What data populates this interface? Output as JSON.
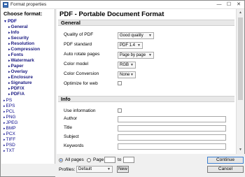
{
  "window": {
    "title": "Format properties",
    "min": "—",
    "max": "☐",
    "close": "✕"
  },
  "left": {
    "heading": "Choose format:",
    "formats": [
      {
        "label": "PDF",
        "children": [
          "General",
          "Info",
          "Security",
          "Resolution",
          "Compression",
          "Fonts",
          "Watermark",
          "Paper",
          "Overlay",
          "Enclosure",
          "Signature",
          "PDF/X",
          "PDF/A"
        ]
      },
      {
        "label": "PS"
      },
      {
        "label": "EPS"
      },
      {
        "label": "PCL"
      },
      {
        "label": "PNG"
      },
      {
        "label": "JPEG"
      },
      {
        "label": "BMP"
      },
      {
        "label": "PCX"
      },
      {
        "label": "TIFF"
      },
      {
        "label": "PSD"
      },
      {
        "label": "TXT"
      }
    ]
  },
  "main": {
    "title": "PDF - Portable Document Format",
    "general": {
      "heading": "General",
      "quality_label": "Quality of PDF",
      "quality_value": "Good quality",
      "standard_label": "PDF standard",
      "standard_value": "PDF 1.4",
      "rotate_label": "Auto rotate pages",
      "rotate_value": "Page by page",
      "color_model_label": "Color model",
      "color_model_value": "RGB",
      "conversion_label": "Color Conversion",
      "conversion_value": "None",
      "optimize_label": "Optimize for web"
    },
    "info": {
      "heading": "Info",
      "use_info_label": "Use information",
      "author_label": "Author",
      "title_label": "Title",
      "subject_label": "Subject",
      "keywords_label": "Keywords"
    }
  },
  "bottom": {
    "all_pages": "All pages",
    "page": "Page",
    "to": "to",
    "profiles_label": "Profiles:",
    "profile_value": "Default",
    "new_button": "New",
    "continue_button": "Continue",
    "cancel_button": "Cancel"
  },
  "colors": {
    "link": "#0a0a8c",
    "section_bg": "#e8e8e8",
    "accent": "#1d5fcf"
  }
}
